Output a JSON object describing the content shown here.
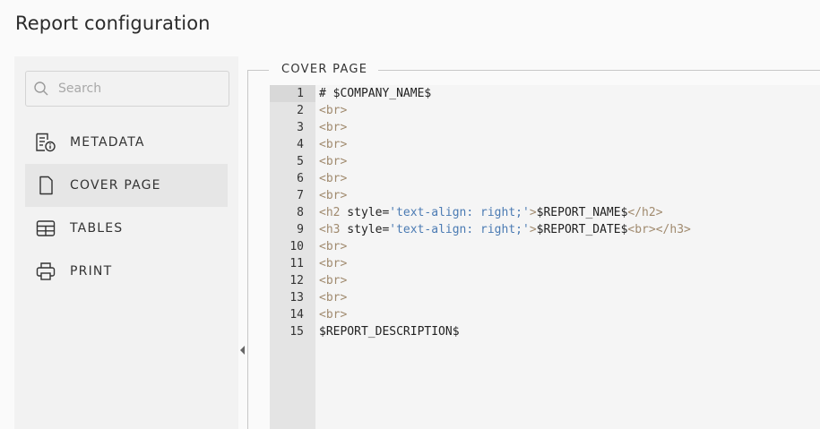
{
  "header": {
    "title": "Report configuration"
  },
  "sidebar": {
    "search_placeholder": "Search",
    "items": [
      {
        "label": "METADATA",
        "icon": "metadata-icon",
        "active": false
      },
      {
        "label": "COVER PAGE",
        "icon": "page-icon",
        "active": true
      },
      {
        "label": "TABLES",
        "icon": "table-icon",
        "active": false
      },
      {
        "label": "PRINT",
        "icon": "printer-icon",
        "active": false
      }
    ]
  },
  "section": {
    "title": "COVER PAGE"
  },
  "editor": {
    "lines": [
      {
        "n": "1",
        "parts": [
          {
            "t": "txt",
            "v": "# $COMPANY_NAME$"
          }
        ]
      },
      {
        "n": "2",
        "parts": [
          {
            "t": "tag",
            "v": "<br>"
          }
        ]
      },
      {
        "n": "3",
        "parts": [
          {
            "t": "tag",
            "v": "<br>"
          }
        ]
      },
      {
        "n": "4",
        "parts": [
          {
            "t": "tag",
            "v": "<br>"
          }
        ]
      },
      {
        "n": "5",
        "parts": [
          {
            "t": "tag",
            "v": "<br>"
          }
        ]
      },
      {
        "n": "6",
        "parts": [
          {
            "t": "tag",
            "v": "<br>"
          }
        ]
      },
      {
        "n": "7",
        "parts": [
          {
            "t": "tag",
            "v": "<br>"
          }
        ]
      },
      {
        "n": "8",
        "parts": [
          {
            "t": "tag",
            "v": "<h2"
          },
          {
            "t": "txt",
            "v": " style="
          },
          {
            "t": "str",
            "v": "'text-align: right;'"
          },
          {
            "t": "tag",
            "v": ">"
          },
          {
            "t": "txt",
            "v": "$REPORT_NAME$"
          },
          {
            "t": "tag",
            "v": "</h2>"
          }
        ]
      },
      {
        "n": "9",
        "parts": [
          {
            "t": "tag",
            "v": "<h3"
          },
          {
            "t": "txt",
            "v": " style="
          },
          {
            "t": "str",
            "v": "'text-align: right;'"
          },
          {
            "t": "tag",
            "v": ">"
          },
          {
            "t": "txt",
            "v": "$REPORT_DATE$"
          },
          {
            "t": "tag",
            "v": "<br></h3>"
          }
        ]
      },
      {
        "n": "10",
        "parts": [
          {
            "t": "tag",
            "v": "<br>"
          }
        ]
      },
      {
        "n": "11",
        "parts": [
          {
            "t": "tag",
            "v": "<br>"
          }
        ]
      },
      {
        "n": "12",
        "parts": [
          {
            "t": "tag",
            "v": "<br>"
          }
        ]
      },
      {
        "n": "13",
        "parts": [
          {
            "t": "tag",
            "v": "<br>"
          }
        ]
      },
      {
        "n": "14",
        "parts": [
          {
            "t": "tag",
            "v": "<br>"
          }
        ]
      },
      {
        "n": "15",
        "parts": [
          {
            "t": "txt",
            "v": "$REPORT_DESCRIPTION$"
          }
        ]
      }
    ]
  }
}
